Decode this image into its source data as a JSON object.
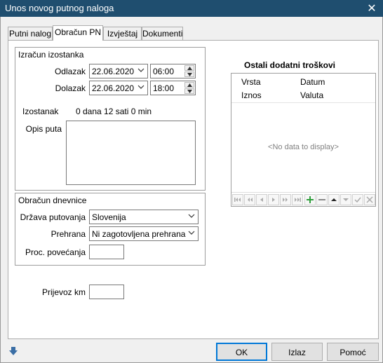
{
  "window": {
    "title": "Unos novog putnog naloga"
  },
  "tabs": [
    {
      "label": "Putni nalog"
    },
    {
      "label": "Obračun PN"
    },
    {
      "label": "Izvještaj"
    },
    {
      "label": "Dokumenti"
    }
  ],
  "izracun": {
    "title": "Izračun izostanka",
    "odlazak_label": "Odlazak",
    "odlazak_date": "22.06.2020",
    "odlazak_time": "06:00",
    "dolazak_label": "Dolazak",
    "dolazak_date": "22.06.2020",
    "dolazak_time": "18:00",
    "izostanak_label": "Izostanak",
    "izostanak_value": "0 dana 12 sati 0 min",
    "opis_label": "Opis puta",
    "opis_value": ""
  },
  "dnevnice": {
    "title": "Obračun dnevnice",
    "drzava_label": "Država putovanja",
    "drzava_value": "Slovenija",
    "prehrana_label": "Prehrana",
    "prehrana_value": "Ni zagotovljena prehrana",
    "povecanja_label": "Proc. povećanja",
    "povecanja_value": ""
  },
  "prijevoz": {
    "label": "Prijevoz km",
    "value": ""
  },
  "troskovi": {
    "title": "Ostali dodatni troškovi",
    "columns": [
      "Vrsta",
      "Datum",
      "Iznos",
      "Valuta"
    ],
    "empty_text": "<No data to display>"
  },
  "buttons": {
    "ok": "OK",
    "izlaz": "Izlaz",
    "pomoc": "Pomoć"
  },
  "colors": {
    "titlebar": "#1f4e6f",
    "accent": "#0078d7",
    "add_green": "#2e9e3a"
  }
}
